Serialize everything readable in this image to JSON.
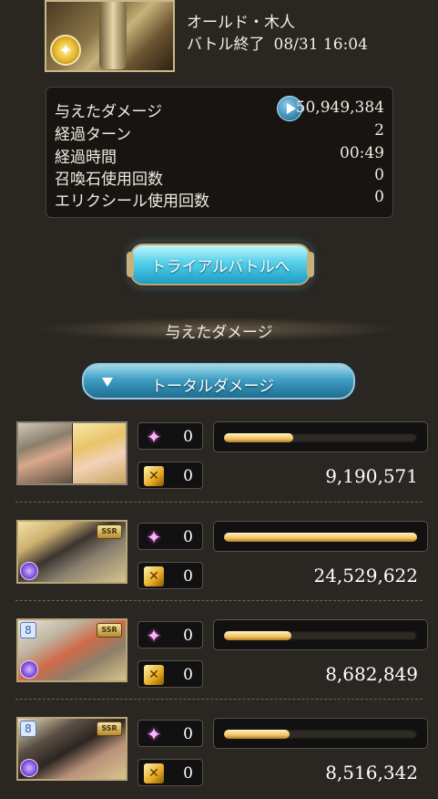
{
  "header": {
    "boss_name": "オールド・木人",
    "battle_status": "バトル終了",
    "timestamp": "08/31 16:04"
  },
  "stats": [
    {
      "label": "与えたダメージ",
      "value": "50,949,384"
    },
    {
      "label": "経過ターン",
      "value": "2"
    },
    {
      "label": "経過時間",
      "value": "00:49"
    },
    {
      "label": "召喚石使用回数",
      "value": "0"
    },
    {
      "label": "エリクシール使用回数",
      "value": "0"
    }
  ],
  "trial_button": {
    "label": "トライアルバトルへ"
  },
  "section": {
    "title": "与えたダメージ"
  },
  "damage_tab": {
    "label": "トータルダメージ"
  },
  "characters": [
    {
      "star_count": "0",
      "ca_count": "0",
      "damage": "9,190,571",
      "bar_fraction": 0.36
    },
    {
      "star_count": "0",
      "ca_count": "0",
      "damage": "24,529,622",
      "bar_fraction": 1.0,
      "rarity": "SSR"
    },
    {
      "star_count": "0",
      "ca_count": "0",
      "damage": "8,682,849",
      "bar_fraction": 0.35,
      "rarity": "SSR"
    },
    {
      "star_count": "0",
      "ca_count": "0",
      "damage": "8,516,342",
      "bar_fraction": 0.34,
      "rarity": "SSR"
    }
  ],
  "colors": {
    "accent_blue": "#3e9fc2",
    "bar_gold": "#f2c363",
    "background": "#2a2722"
  }
}
